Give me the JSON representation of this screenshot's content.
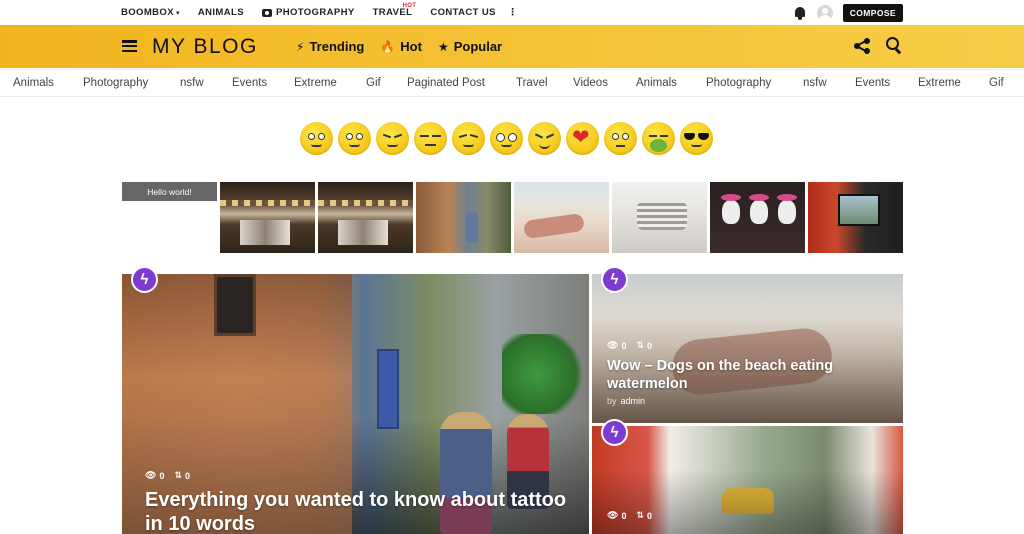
{
  "topnav": {
    "items": [
      {
        "label": "BOOMBOX",
        "chevron": "▾"
      },
      {
        "label": "ANIMALS"
      },
      {
        "label": "PHOTOGRAPHY",
        "icon": "camera-icon"
      },
      {
        "label": "TRAVEL",
        "badge": "HOT"
      },
      {
        "label": "CONTACT US"
      }
    ],
    "more": "⋮",
    "compose_label": "COMPOSE"
  },
  "header": {
    "logo": "MY BLOG",
    "nav": [
      {
        "label": "Trending",
        "icon": "⚡"
      },
      {
        "label": "Hot",
        "icon": "🔥"
      },
      {
        "label": "Popular",
        "icon": "★"
      }
    ]
  },
  "categories": [
    "Animals",
    "Photography",
    "nsfw",
    "Events",
    "Extreme",
    "Gif",
    "Paginated Post",
    "Travel",
    "Videos",
    "Animals",
    "Photography",
    "nsfw",
    "Events",
    "Extreme",
    "Gif"
  ],
  "reactions": [
    "dizzy",
    "crying-laugh",
    "squint",
    "expressionless",
    "wink-tongue",
    "nerd",
    "laughing",
    "love",
    "confused",
    "sick",
    "cool"
  ],
  "thumbnails": {
    "hello_label": "Hello world!",
    "items": [
      "cafe",
      "cafe",
      "alley",
      "beach",
      "bedroom",
      "skull-girls",
      "game-screen"
    ]
  },
  "cards": [
    {
      "title": "Everything you wanted to know about tattoo in 10 words",
      "views": "0",
      "votes": "0",
      "badge": "ϟ"
    },
    {
      "title": "Wow – Dogs on the beach eating watermelon",
      "views": "0",
      "votes": "0",
      "by_label": "by",
      "author": "admin",
      "badge": "ϟ"
    },
    {
      "views": "0",
      "votes": "0",
      "badge": "ϟ"
    }
  ],
  "colors": {
    "accent": "#f4c43a",
    "badge": "#7e3bd1",
    "hot": "#e3262c"
  }
}
